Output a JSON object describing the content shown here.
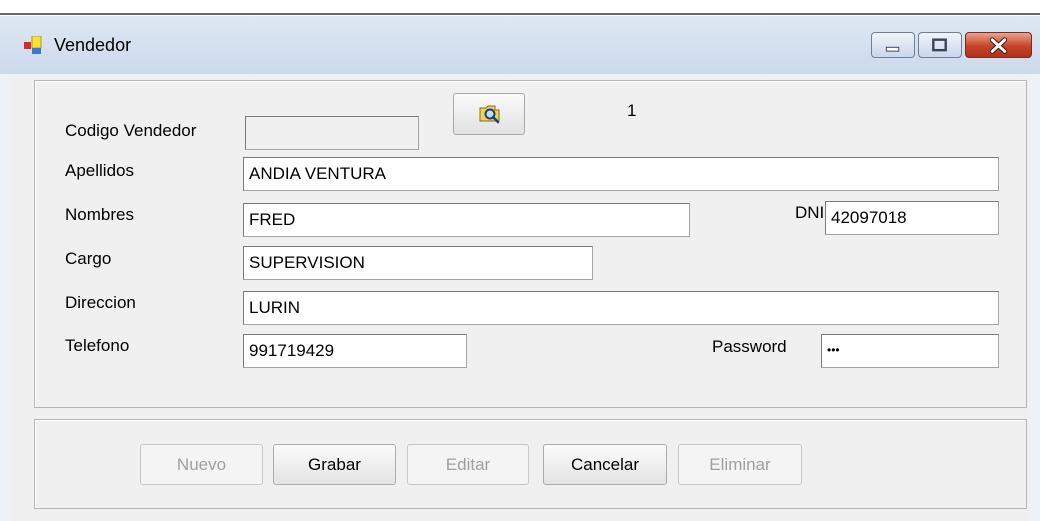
{
  "window": {
    "title": "Vendedor",
    "app_icon": "form-icon"
  },
  "titlebar_buttons": {
    "minimize_icon": "minimize-icon",
    "maximize_icon": "maximize-icon",
    "close_icon": "close-icon"
  },
  "form": {
    "codigo_label": "Codigo Vendedor",
    "codigo_value": "",
    "search_icon": "search-icon",
    "record_number": "1",
    "apellidos_label": "Apellidos",
    "apellidos_value": "ANDIA VENTURA",
    "nombres_label": "Nombres",
    "nombres_value": "FRED",
    "dni_label": "DNI",
    "dni_value": "42097018",
    "cargo_label": "Cargo",
    "cargo_value": "SUPERVISION",
    "direccion_label": "Direccion",
    "direccion_value": "LURIN",
    "telefono_label": "Telefono",
    "telefono_value": "991719429",
    "password_label": "Password",
    "password_value": "•••"
  },
  "actions": {
    "nuevo": "Nuevo",
    "grabar": "Grabar",
    "editar": "Editar",
    "cancelar": "Cancelar",
    "eliminar": "Eliminar"
  },
  "colors": {
    "title_bar": "#cbd9ec",
    "close_button": "#c5432a",
    "disabled_text": "#a0a0a0"
  }
}
